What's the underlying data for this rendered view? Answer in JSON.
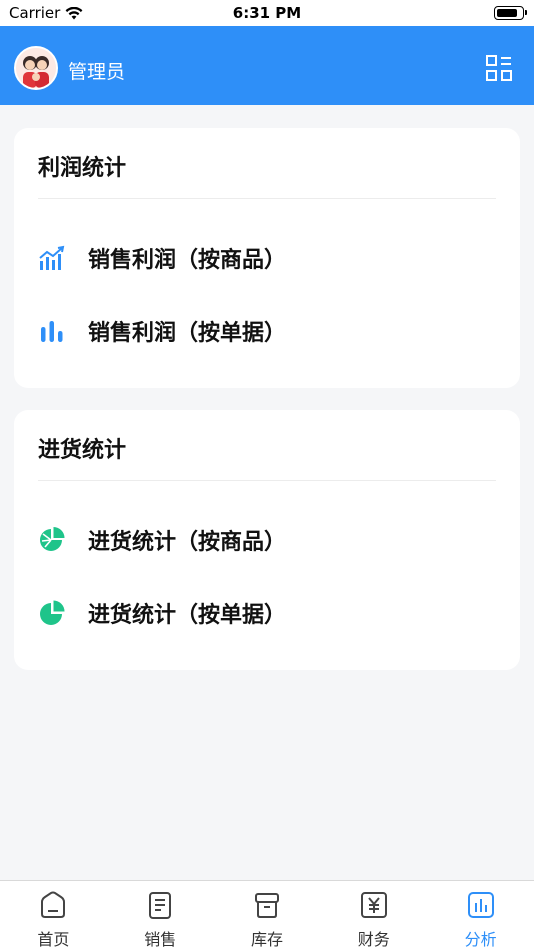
{
  "status_bar": {
    "carrier": "Carrier",
    "time": "6:31 PM"
  },
  "header": {
    "title": "管理员",
    "avatar_icon": "avatar-couple-icon",
    "menu_icon": "grid-menu-icon"
  },
  "sections": [
    {
      "title": "利润统计",
      "items": [
        {
          "label": "销售利润（按商品）",
          "icon": "line-bar-chart-icon",
          "color": "#2e8ff8"
        },
        {
          "label": "销售利润（按单据）",
          "icon": "bar-chart-icon",
          "color": "#2e8ff8"
        }
      ]
    },
    {
      "title": "进货统计",
      "items": [
        {
          "label": "进货统计（按商品）",
          "icon": "pie-chart-lines-icon",
          "color": "#1fc48a"
        },
        {
          "label": "进货统计（按单据）",
          "icon": "pie-chart-icon",
          "color": "#1fc48a"
        }
      ]
    }
  ],
  "tabs": [
    {
      "label": "首页",
      "icon": "home-icon",
      "active": false
    },
    {
      "label": "销售",
      "icon": "document-icon",
      "active": false
    },
    {
      "label": "库存",
      "icon": "inventory-box-icon",
      "active": false
    },
    {
      "label": "财务",
      "icon": "yen-icon",
      "active": false
    },
    {
      "label": "分析",
      "icon": "analysis-chart-icon",
      "active": true
    }
  ],
  "colors": {
    "primary": "#2e8ff8",
    "green": "#1fc48a",
    "background": "#f5f6f8"
  }
}
